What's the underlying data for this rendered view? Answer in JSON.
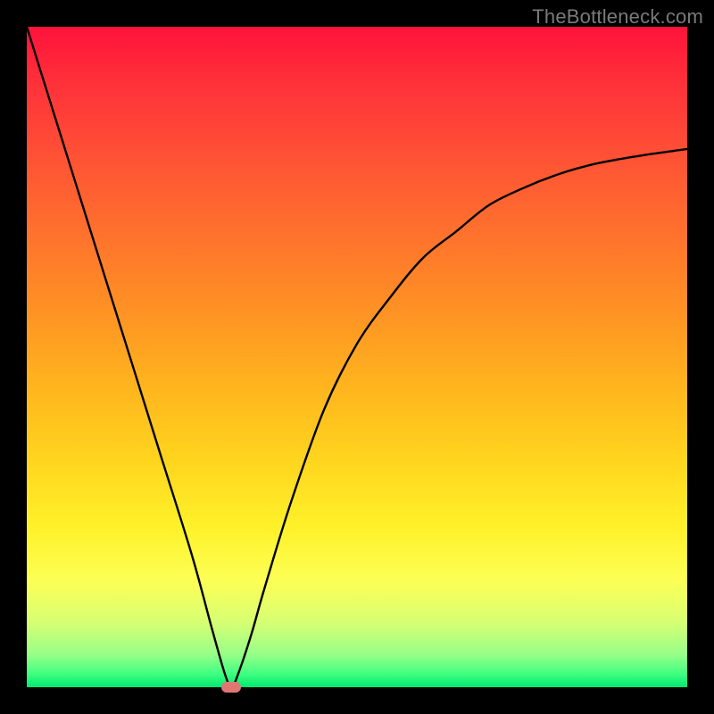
{
  "watermark": "TheBottleneck.com",
  "colors": {
    "curve_stroke": "#000000",
    "marker_fill": "#e07772",
    "background_frame": "#000000"
  },
  "chart_data": {
    "type": "line",
    "title": "",
    "xlabel": "",
    "ylabel": "",
    "xlim": [
      0,
      100
    ],
    "ylim": [
      0,
      100
    ],
    "grid": false,
    "legend": false,
    "series": [
      {
        "name": "bottleneck-curve",
        "x": [
          0,
          5,
          10,
          15,
          20,
          25,
          28,
          30,
          31,
          32,
          34,
          36,
          40,
          45,
          50,
          55,
          60,
          65,
          70,
          75,
          80,
          85,
          90,
          95,
          100
        ],
        "y": [
          100,
          84,
          68,
          52,
          36,
          20,
          9,
          2,
          0,
          2,
          8,
          15,
          28,
          42,
          52,
          59,
          65,
          69,
          73,
          75.5,
          77.5,
          79,
          80,
          80.8,
          81.5
        ]
      }
    ],
    "annotations": [
      {
        "name": "min-marker",
        "x": 31,
        "y": 0
      }
    ],
    "background_gradient": {
      "top": "#ff123b",
      "bottom": "#00e870",
      "meaning": "red=high bottleneck, green=low bottleneck"
    }
  }
}
